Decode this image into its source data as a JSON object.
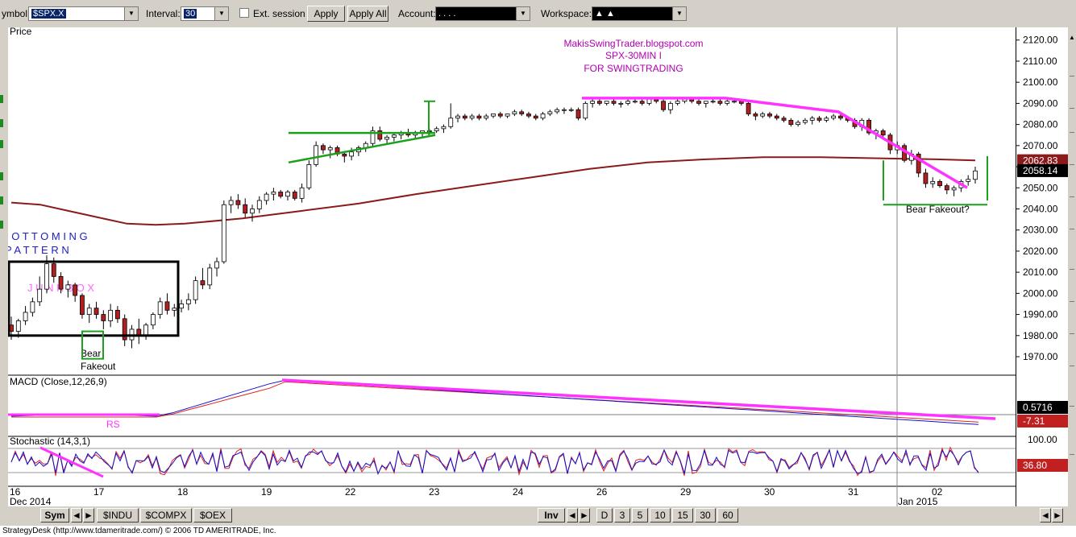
{
  "toolbar": {
    "symbol_label": "ymbol:",
    "symbol_value": "$SPX.X",
    "interval_label": "Interval:",
    "interval_value": "30",
    "ext_session_label": "Ext. session",
    "apply_label": "Apply",
    "apply_all_label": "Apply All",
    "account_label": "Account:",
    "account_value": ". . . .",
    "workspace_label": "Workspace:",
    "workspace_value": "▲ ▲"
  },
  "bottom_bar": {
    "sym_label": "Sym",
    "symbol_tabs": [
      "$INDU",
      "$COMPX",
      "$OEX"
    ],
    "inv_label": "Inv",
    "interval_tabs": [
      "D",
      "3",
      "5",
      "10",
      "15",
      "30",
      "60"
    ]
  },
  "status_text": "StrategyDesk (http://www.tdameritrade.com/) © 2006 TD AMERITRADE, Inc.",
  "colors": {
    "annotation_magenta": "#ff33ff",
    "annotation_green": "#1aa01a",
    "moving_average": "#8b1a1a",
    "macd_line": "#1010d0",
    "signal_line": "#e02020",
    "price_up_fill": "#ffffff",
    "price_down_fill": "#b02020"
  },
  "chart_data": [
    {
      "type": "candlestick",
      "title": "Price",
      "annotations_text": {
        "site": "MakisSwingTrader.blogspot.com",
        "subtitle": "SPX-30MIN I",
        "subtitle2": "FOR SWINGTRADING",
        "bottoming": "B O T T O M I N G",
        "pattern": "P A T T E R N",
        "junk_box": "J U N K   B O X",
        "bear_fakeout_left_1": "Bear",
        "bear_fakeout_left_2": "Fakeout",
        "bear_fakeout_right": "Bear Fakeout?"
      },
      "ylim": [
        1962,
        2126
      ],
      "y_ticks": [
        "2120.00",
        "2110.00",
        "2100.00",
        "2090.00",
        "2080.00",
        "2070.00",
        "2060.00",
        "2050.00",
        "2040.00",
        "2030.00",
        "2020.00",
        "2010.00",
        "2000.00",
        "1990.00",
        "1980.00",
        "1970.00"
      ],
      "last_price": "2058.14",
      "moving_average_value": "2062.83",
      "x_ticks": [
        "16",
        "17",
        "18",
        "19",
        "22",
        "23",
        "24",
        "26",
        "29",
        "30",
        "31",
        "02"
      ],
      "x_sublabels": [
        "Dec 2014",
        "Jan 2015"
      ],
      "moving_average": [
        {
          "bar": 0,
          "v": 2043
        },
        {
          "bar": 6,
          "v": 2042
        },
        {
          "bar": 12,
          "v": 2039
        },
        {
          "bar": 18,
          "v": 2036
        },
        {
          "bar": 24,
          "v": 2033
        },
        {
          "bar": 30,
          "v": 2032.5
        },
        {
          "bar": 36,
          "v": 2033
        },
        {
          "bar": 48,
          "v": 2035.5
        },
        {
          "bar": 60,
          "v": 2039
        },
        {
          "bar": 72,
          "v": 2042.5
        },
        {
          "bar": 84,
          "v": 2047
        },
        {
          "bar": 96,
          "v": 2051
        },
        {
          "bar": 108,
          "v": 2055
        },
        {
          "bar": 120,
          "v": 2059
        },
        {
          "bar": 132,
          "v": 2062
        },
        {
          "bar": 144,
          "v": 2063.5
        },
        {
          "bar": 156,
          "v": 2064.5
        },
        {
          "bar": 168,
          "v": 2064.5
        },
        {
          "bar": 180,
          "v": 2064
        },
        {
          "bar": 192,
          "v": 2063.5
        },
        {
          "bar": 200,
          "v": 2063
        }
      ],
      "ohlc": [
        [
          1985,
          1989,
          1978,
          1982
        ],
        [
          1982,
          1988,
          1979,
          1987
        ],
        [
          1987,
          1994,
          1985,
          1991
        ],
        [
          1991,
          1998,
          1989,
          1996
        ],
        [
          1996,
          2008,
          1994,
          2002
        ],
        [
          2002,
          2018,
          2000,
          2014
        ],
        [
          2014,
          2017,
          2005,
          2008
        ],
        [
          2008,
          2010,
          2000,
          2002
        ],
        [
          2002,
          2006,
          1998,
          2004
        ],
        [
          2004,
          2005,
          1996,
          1999
        ],
        [
          1999,
          2000,
          1988,
          1990
        ],
        [
          1990,
          1995,
          1986,
          1993
        ],
        [
          1993,
          1996,
          1988,
          1990
        ],
        [
          1990,
          1992,
          1983,
          1987
        ],
        [
          1987,
          1995,
          1984,
          1992
        ],
        [
          1992,
          1994,
          1986,
          1988
        ],
        [
          1988,
          1990,
          1975,
          1978
        ],
        [
          1978,
          1985,
          1974,
          1983
        ],
        [
          1983,
          1988,
          1976,
          1980
        ],
        [
          1980,
          1986,
          1978,
          1985
        ],
        [
          1985,
          1991,
          1983,
          1990
        ],
        [
          1990,
          1998,
          1988,
          1996
        ],
        [
          1996,
          2000,
          1990,
          1992
        ],
        [
          1992,
          1995,
          1989,
          1993
        ],
        [
          1993,
          1997,
          1991,
          1995
        ],
        [
          1995,
          2000,
          1992,
          1997
        ],
        [
          1997,
          2008,
          1995,
          2006
        ],
        [
          2006,
          2012,
          2002,
          2004
        ],
        [
          2004,
          2014,
          2002,
          2012
        ],
        [
          2012,
          2017,
          2008,
          2015
        ],
        [
          2015,
          2044,
          2014,
          2042
        ],
        [
          2042,
          2046,
          2038,
          2044
        ],
        [
          2044,
          2047,
          2040,
          2042
        ],
        [
          2042,
          2045,
          2036,
          2038
        ],
        [
          2038,
          2042,
          2034,
          2040
        ],
        [
          2040,
          2046,
          2038,
          2044
        ],
        [
          2044,
          2048,
          2042,
          2047
        ],
        [
          2047,
          2050,
          2044,
          2048
        ],
        [
          2048,
          2049,
          2045,
          2046
        ],
        [
          2046,
          2049,
          2044,
          2048
        ],
        [
          2048,
          2049,
          2044,
          2045
        ],
        [
          2045,
          2052,
          2043,
          2050
        ],
        [
          2050,
          2063,
          2049,
          2061
        ],
        [
          2061,
          2072,
          2060,
          2070
        ],
        [
          2070,
          2071,
          2066,
          2068
        ],
        [
          2068,
          2070,
          2064,
          2069
        ],
        [
          2069,
          2070,
          2065,
          2066
        ],
        [
          2066,
          2067,
          2062,
          2065
        ],
        [
          2065,
          2069,
          2063,
          2067
        ],
        [
          2067,
          2070,
          2065,
          2069
        ],
        [
          2069,
          2072,
          2067,
          2071
        ],
        [
          2071,
          2079,
          2069,
          2077
        ],
        [
          2077,
          2079,
          2072,
          2073
        ],
        [
          2073,
          2075,
          2071,
          2074
        ],
        [
          2074,
          2076,
          2072,
          2075
        ],
        [
          2075,
          2077,
          2073,
          2076
        ],
        [
          2076,
          2078,
          2074,
          2075
        ],
        [
          2075,
          2077,
          2073,
          2076
        ],
        [
          2076,
          2077,
          2074,
          2077
        ],
        [
          2077,
          2078,
          2075,
          2077
        ],
        [
          2077,
          2079,
          2076,
          2078
        ],
        [
          2078,
          2080,
          2076,
          2079
        ],
        [
          2079,
          2090,
          2078,
          2083
        ],
        [
          2083,
          2085,
          2081,
          2084
        ],
        [
          2084,
          2085,
          2082,
          2083
        ],
        [
          2083,
          2085,
          2082,
          2084
        ],
        [
          2084,
          2085,
          2082,
          2083
        ],
        [
          2083,
          2085,
          2082,
          2084
        ],
        [
          2084,
          2085,
          2083,
          2085
        ],
        [
          2085,
          2086,
          2083,
          2084
        ],
        [
          2084,
          2085,
          2083,
          2085
        ],
        [
          2085,
          2087,
          2084,
          2086
        ],
        [
          2086,
          2087,
          2084,
          2085
        ],
        [
          2085,
          2086,
          2083,
          2084
        ],
        [
          2084,
          2085,
          2082,
          2083
        ],
        [
          2083,
          2086,
          2082,
          2085
        ],
        [
          2085,
          2087,
          2084,
          2086
        ],
        [
          2086,
          2088,
          2085,
          2087
        ],
        [
          2087,
          2088,
          2085,
          2087
        ],
        [
          2087,
          2088,
          2086,
          2087
        ],
        [
          2087,
          2088,
          2082,
          2083
        ],
        [
          2083,
          2091,
          2082,
          2090
        ],
        [
          2090,
          2092,
          2088,
          2091
        ],
        [
          2091,
          2092,
          2089,
          2090
        ],
        [
          2090,
          2091,
          2089,
          2091
        ],
        [
          2091,
          2092,
          2089,
          2090
        ],
        [
          2090,
          2091,
          2088,
          2090
        ],
        [
          2090,
          2092,
          2089,
          2091
        ],
        [
          2091,
          2092,
          2090,
          2091
        ],
        [
          2091,
          2092,
          2089,
          2090
        ],
        [
          2090,
          2092,
          2089,
          2092
        ],
        [
          2092,
          2093,
          2090,
          2091
        ],
        [
          2091,
          2092,
          2086,
          2087
        ],
        [
          2087,
          2091,
          2085,
          2090
        ],
        [
          2090,
          2092,
          2089,
          2091
        ],
        [
          2091,
          2092,
          2090,
          2092
        ],
        [
          2092,
          2093,
          2090,
          2091
        ],
        [
          2091,
          2092,
          2089,
          2090
        ],
        [
          2090,
          2091,
          2088,
          2091
        ],
        [
          2091,
          2092,
          2090,
          2091
        ],
        [
          2091,
          2092,
          2089,
          2090
        ],
        [
          2090,
          2092,
          2089,
          2091
        ],
        [
          2091,
          2092,
          2090,
          2091
        ],
        [
          2091,
          2092,
          2089,
          2090
        ],
        [
          2090,
          2091,
          2084,
          2085
        ],
        [
          2085,
          2086,
          2082,
          2084
        ],
        [
          2084,
          2086,
          2083,
          2085
        ],
        [
          2085,
          2086,
          2083,
          2084
        ],
        [
          2084,
          2085,
          2082,
          2083
        ],
        [
          2083,
          2084,
          2081,
          2082
        ],
        [
          2082,
          2083,
          2079,
          2080
        ],
        [
          2080,
          2082,
          2079,
          2081
        ],
        [
          2081,
          2083,
          2080,
          2082
        ],
        [
          2082,
          2084,
          2080,
          2083
        ],
        [
          2083,
          2084,
          2081,
          2082
        ],
        [
          2082,
          2084,
          2081,
          2083
        ],
        [
          2083,
          2085,
          2082,
          2084
        ],
        [
          2084,
          2085,
          2082,
          2083
        ],
        [
          2083,
          2084,
          2081,
          2082
        ],
        [
          2082,
          2083,
          2078,
          2079
        ],
        [
          2079,
          2083,
          2077,
          2082
        ],
        [
          2082,
          2083,
          2075,
          2076
        ],
        [
          2076,
          2078,
          2073,
          2077
        ],
        [
          2077,
          2078,
          2074,
          2075
        ],
        [
          2075,
          2076,
          2066,
          2068
        ],
        [
          2068,
          2072,
          2066,
          2070
        ],
        [
          2070,
          2071,
          2062,
          2063
        ],
        [
          2063,
          2068,
          2061,
          2066
        ],
        [
          2066,
          2067,
          2055,
          2057
        ],
        [
          2057,
          2059,
          2050,
          2052
        ],
        [
          2052,
          2055,
          2050,
          2053
        ],
        [
          2053,
          2054,
          2050,
          2051
        ],
        [
          2051,
          2052,
          2047,
          2049
        ],
        [
          2049,
          2051,
          2046,
          2050
        ],
        [
          2050,
          2054,
          2048,
          2053
        ],
        [
          2053,
          2056,
          2051,
          2054
        ],
        [
          2054,
          2060,
          2052,
          2058
        ]
      ]
    },
    {
      "type": "line",
      "title": "MACD (Close,12,26,9)",
      "series": [
        {
          "name": "MACD",
          "last": "0.5716"
        },
        {
          "name": "Signal",
          "last": "-7.31"
        }
      ]
    },
    {
      "type": "line",
      "title": "Stochastic (14,3,1)",
      "levels": [
        "100.00"
      ],
      "last_value": "36.80"
    }
  ]
}
